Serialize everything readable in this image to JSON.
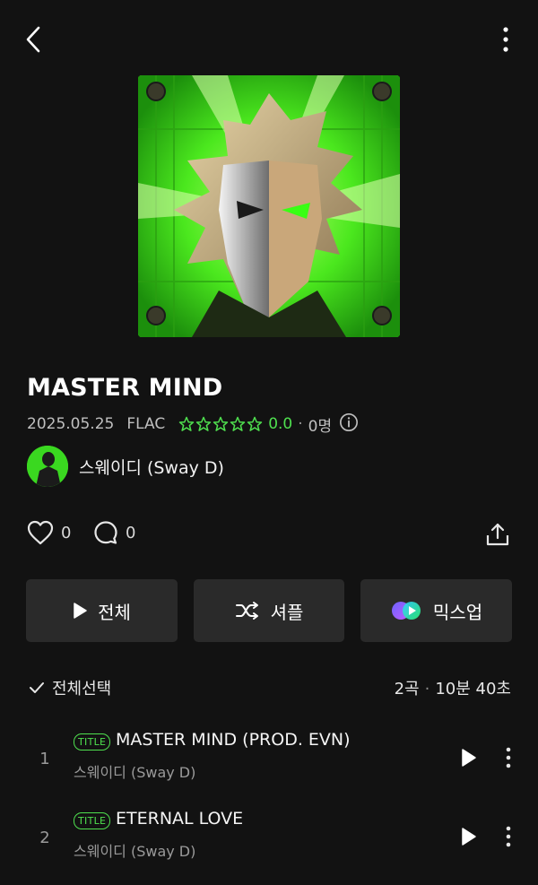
{
  "header": {
    "back_icon": "chevron-left-icon",
    "more_icon": "vertical-dots-icon"
  },
  "album": {
    "title": "MASTER MIND",
    "release_date": "2025.05.25",
    "format": "FLAC",
    "rating": "0.0",
    "rating_fraction": 0,
    "rating_count": "0명",
    "artist": "스웨이디 (Sway D)",
    "accent_color": "#4fe04f"
  },
  "actions": {
    "likes": "0",
    "comments": "0",
    "share_icon": "share-upload-icon"
  },
  "buttons": {
    "play_all": "전체",
    "shuffle": "셔플",
    "mixup": "믹스업"
  },
  "list_header": {
    "select_all": "전체선택",
    "track_count": "2곡",
    "duration": "10분 40초"
  },
  "tracks": [
    {
      "number": "1",
      "badge": "TITLE",
      "title": "MASTER MIND (PROD. EVN)",
      "artist": "스웨이디 (Sway D)"
    },
    {
      "number": "2",
      "badge": "TITLE",
      "title": "ETERNAL LOVE",
      "artist": "스웨이디 (Sway D)"
    }
  ]
}
